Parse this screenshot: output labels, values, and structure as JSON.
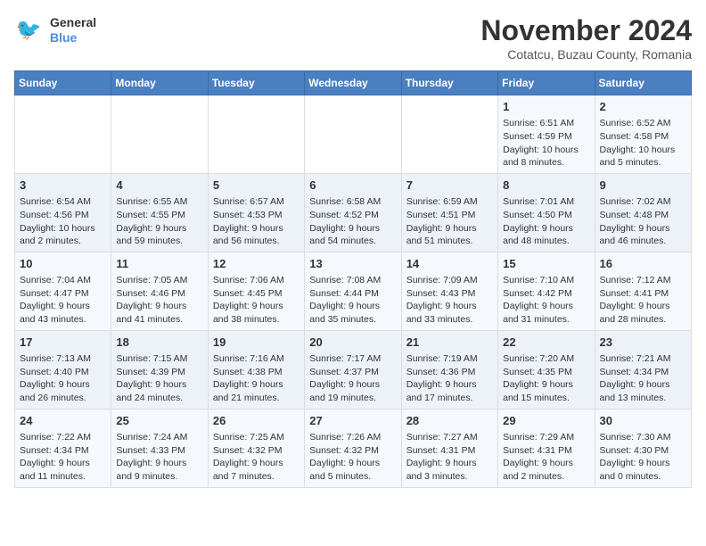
{
  "header": {
    "logo_line1": "General",
    "logo_line2": "Blue",
    "month_title": "November 2024",
    "location": "Cotatcu, Buzau County, Romania"
  },
  "weekdays": [
    "Sunday",
    "Monday",
    "Tuesday",
    "Wednesday",
    "Thursday",
    "Friday",
    "Saturday"
  ],
  "weeks": [
    [
      {
        "day": "",
        "info": ""
      },
      {
        "day": "",
        "info": ""
      },
      {
        "day": "",
        "info": ""
      },
      {
        "day": "",
        "info": ""
      },
      {
        "day": "",
        "info": ""
      },
      {
        "day": "1",
        "info": "Sunrise: 6:51 AM\nSunset: 4:59 PM\nDaylight: 10 hours and 8 minutes."
      },
      {
        "day": "2",
        "info": "Sunrise: 6:52 AM\nSunset: 4:58 PM\nDaylight: 10 hours and 5 minutes."
      }
    ],
    [
      {
        "day": "3",
        "info": "Sunrise: 6:54 AM\nSunset: 4:56 PM\nDaylight: 10 hours and 2 minutes."
      },
      {
        "day": "4",
        "info": "Sunrise: 6:55 AM\nSunset: 4:55 PM\nDaylight: 9 hours and 59 minutes."
      },
      {
        "day": "5",
        "info": "Sunrise: 6:57 AM\nSunset: 4:53 PM\nDaylight: 9 hours and 56 minutes."
      },
      {
        "day": "6",
        "info": "Sunrise: 6:58 AM\nSunset: 4:52 PM\nDaylight: 9 hours and 54 minutes."
      },
      {
        "day": "7",
        "info": "Sunrise: 6:59 AM\nSunset: 4:51 PM\nDaylight: 9 hours and 51 minutes."
      },
      {
        "day": "8",
        "info": "Sunrise: 7:01 AM\nSunset: 4:50 PM\nDaylight: 9 hours and 48 minutes."
      },
      {
        "day": "9",
        "info": "Sunrise: 7:02 AM\nSunset: 4:48 PM\nDaylight: 9 hours and 46 minutes."
      }
    ],
    [
      {
        "day": "10",
        "info": "Sunrise: 7:04 AM\nSunset: 4:47 PM\nDaylight: 9 hours and 43 minutes."
      },
      {
        "day": "11",
        "info": "Sunrise: 7:05 AM\nSunset: 4:46 PM\nDaylight: 9 hours and 41 minutes."
      },
      {
        "day": "12",
        "info": "Sunrise: 7:06 AM\nSunset: 4:45 PM\nDaylight: 9 hours and 38 minutes."
      },
      {
        "day": "13",
        "info": "Sunrise: 7:08 AM\nSunset: 4:44 PM\nDaylight: 9 hours and 35 minutes."
      },
      {
        "day": "14",
        "info": "Sunrise: 7:09 AM\nSunset: 4:43 PM\nDaylight: 9 hours and 33 minutes."
      },
      {
        "day": "15",
        "info": "Sunrise: 7:10 AM\nSunset: 4:42 PM\nDaylight: 9 hours and 31 minutes."
      },
      {
        "day": "16",
        "info": "Sunrise: 7:12 AM\nSunset: 4:41 PM\nDaylight: 9 hours and 28 minutes."
      }
    ],
    [
      {
        "day": "17",
        "info": "Sunrise: 7:13 AM\nSunset: 4:40 PM\nDaylight: 9 hours and 26 minutes."
      },
      {
        "day": "18",
        "info": "Sunrise: 7:15 AM\nSunset: 4:39 PM\nDaylight: 9 hours and 24 minutes."
      },
      {
        "day": "19",
        "info": "Sunrise: 7:16 AM\nSunset: 4:38 PM\nDaylight: 9 hours and 21 minutes."
      },
      {
        "day": "20",
        "info": "Sunrise: 7:17 AM\nSunset: 4:37 PM\nDaylight: 9 hours and 19 minutes."
      },
      {
        "day": "21",
        "info": "Sunrise: 7:19 AM\nSunset: 4:36 PM\nDaylight: 9 hours and 17 minutes."
      },
      {
        "day": "22",
        "info": "Sunrise: 7:20 AM\nSunset: 4:35 PM\nDaylight: 9 hours and 15 minutes."
      },
      {
        "day": "23",
        "info": "Sunrise: 7:21 AM\nSunset: 4:34 PM\nDaylight: 9 hours and 13 minutes."
      }
    ],
    [
      {
        "day": "24",
        "info": "Sunrise: 7:22 AM\nSunset: 4:34 PM\nDaylight: 9 hours and 11 minutes."
      },
      {
        "day": "25",
        "info": "Sunrise: 7:24 AM\nSunset: 4:33 PM\nDaylight: 9 hours and 9 minutes."
      },
      {
        "day": "26",
        "info": "Sunrise: 7:25 AM\nSunset: 4:32 PM\nDaylight: 9 hours and 7 minutes."
      },
      {
        "day": "27",
        "info": "Sunrise: 7:26 AM\nSunset: 4:32 PM\nDaylight: 9 hours and 5 minutes."
      },
      {
        "day": "28",
        "info": "Sunrise: 7:27 AM\nSunset: 4:31 PM\nDaylight: 9 hours and 3 minutes."
      },
      {
        "day": "29",
        "info": "Sunrise: 7:29 AM\nSunset: 4:31 PM\nDaylight: 9 hours and 2 minutes."
      },
      {
        "day": "30",
        "info": "Sunrise: 7:30 AM\nSunset: 4:30 PM\nDaylight: 9 hours and 0 minutes."
      }
    ]
  ]
}
